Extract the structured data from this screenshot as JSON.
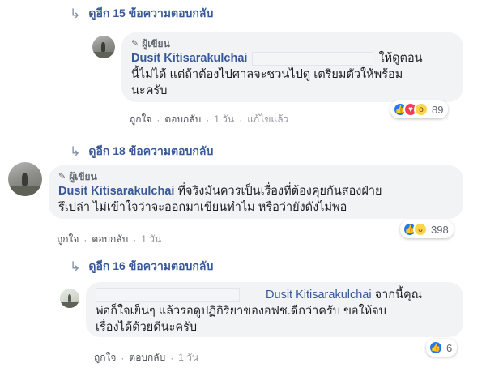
{
  "colors": {
    "link": "#385898",
    "bubble": "#f2f3f5",
    "meta": "#606770",
    "like": "#2078f4",
    "love": "#f33e58",
    "wow": "#fcd54c"
  },
  "reply_link_1": {
    "label": "ดูอีก 15 ข้อความตอบกลับ"
  },
  "comment_1": {
    "author_tag": "ผู้เขียน",
    "author": "Dusit Kitisarakulchai",
    "line1_tail": "ให้ดูตอน",
    "line2": "นี้ไม่ได้ แต่ถ้าต้องไปศาลจะชวนไปดู เตรียมตัวให้พร้อม",
    "line3": "นะครับ",
    "actions": {
      "like": "ถูกใจ",
      "reply": "ตอบกลับ",
      "time": "1 วัน",
      "edited": "แก้ไขแล้ว"
    },
    "reactions": {
      "icons": [
        "like-icon",
        "love-icon",
        "wow-icon"
      ],
      "count": "89"
    }
  },
  "reply_link_2": {
    "label": "ดูอีก 18 ข้อความตอบกลับ"
  },
  "comment_2": {
    "author_tag": "ผู้เขียน",
    "author": "Dusit Kitisarakulchai",
    "line1_tail": "ที่จริงมันควรเป็นเรื่องที่ต้องคุยกันสองฝ่าย",
    "line2": "รึเปล่า ไม่เข้าใจว่าจะออกมาเขียนทำไม หรือว่ายังดังไม่พอ",
    "actions": {
      "like": "ถูกใจ",
      "reply": "ตอบกลับ",
      "time": "1 วัน"
    },
    "reactions": {
      "icons": [
        "like-icon",
        "haha-icon"
      ],
      "count": "398"
    }
  },
  "reply_link_3": {
    "label": "ดูอีก 16 ข้อความตอบกลับ"
  },
  "comment_3": {
    "mention": "Dusit Kitisarakulchai",
    "line1_tail": "จากนี้คุณ",
    "line2": "พ่อก็ใจเย็นๆ แล้วรอดูปฏิกิริยาของอฟช.ดีกว่าครับ ขอให้จบ",
    "line3": "เรื่องได้ด้วยดีนะครับ",
    "actions": {
      "like": "ถูกใจ",
      "reply": "ตอบกลับ",
      "time": "1 วัน"
    },
    "reactions": {
      "icons": [
        "like-icon"
      ],
      "count": "6"
    }
  }
}
